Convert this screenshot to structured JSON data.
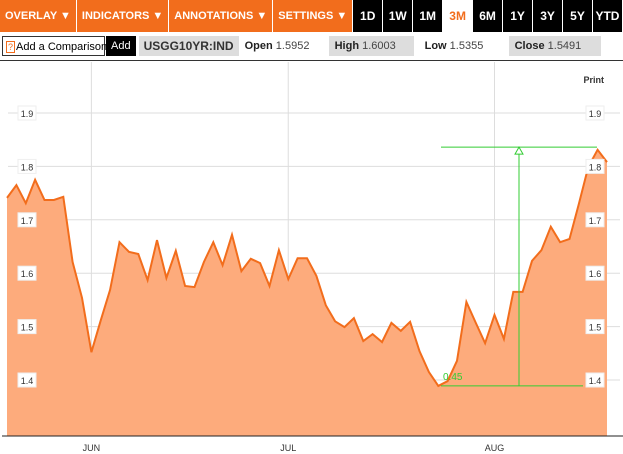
{
  "toolbar": {
    "menus": [
      "OVERLAY ▼",
      "INDICATORS ▼",
      "ANNOTATIONS ▼",
      "SETTINGS ▼"
    ],
    "ranges": [
      "1D",
      "1W",
      "1M",
      "3M",
      "6M",
      "1Y",
      "3Y",
      "5Y",
      "YTD"
    ],
    "active_range": "3M"
  },
  "quote": {
    "help": "?",
    "comparison_placeholder": "Add a Comparison",
    "add_label": "Add",
    "symbol": "USGG10YR:IND",
    "open_label": "Open",
    "open": "1.5952",
    "high_label": "High",
    "high": "1.6003",
    "low_label": "Low",
    "low": "1.5355",
    "close_label": "Close",
    "close": "1.5491"
  },
  "print_label": "Print",
  "colors": {
    "accent": "#f26d1c",
    "fill": "#fdab7c",
    "line": "#f26d1c",
    "measure": "#33cc33"
  },
  "chart_data": {
    "type": "area",
    "ylim": [
      1.3,
      1.9
    ],
    "yticks": [
      1.4,
      1.5,
      1.6,
      1.7,
      1.8,
      1.9
    ],
    "ytick_labels": [
      "1.4",
      "1.5",
      "1.6",
      "1.7",
      "1.8",
      "1.9"
    ],
    "xticks": [
      {
        "label": "JUN",
        "index": 9
      },
      {
        "label": "JUL",
        "index": 30
      },
      {
        "label": "AUG",
        "index": 52
      }
    ],
    "grid": true,
    "values": [
      1.741,
      1.765,
      1.731,
      1.775,
      1.737,
      1.737,
      1.743,
      1.621,
      1.554,
      1.452,
      1.512,
      1.569,
      1.658,
      1.64,
      1.636,
      1.587,
      1.662,
      1.591,
      1.642,
      1.576,
      1.574,
      1.621,
      1.658,
      1.615,
      1.672,
      1.604,
      1.627,
      1.619,
      1.576,
      1.643,
      1.589,
      1.628,
      1.628,
      1.595,
      1.54,
      1.51,
      1.499,
      1.516,
      1.473,
      1.486,
      1.471,
      1.507,
      1.492,
      1.509,
      1.454,
      1.415,
      1.389,
      1.398,
      1.436,
      1.546,
      1.507,
      1.469,
      1.522,
      1.477,
      1.565,
      1.565,
      1.623,
      1.643,
      1.687,
      1.658,
      1.664,
      1.73,
      1.799,
      1.831,
      1.808
    ],
    "measurement": {
      "from": 1.389,
      "to": 1.836,
      "label": "0.45"
    }
  }
}
